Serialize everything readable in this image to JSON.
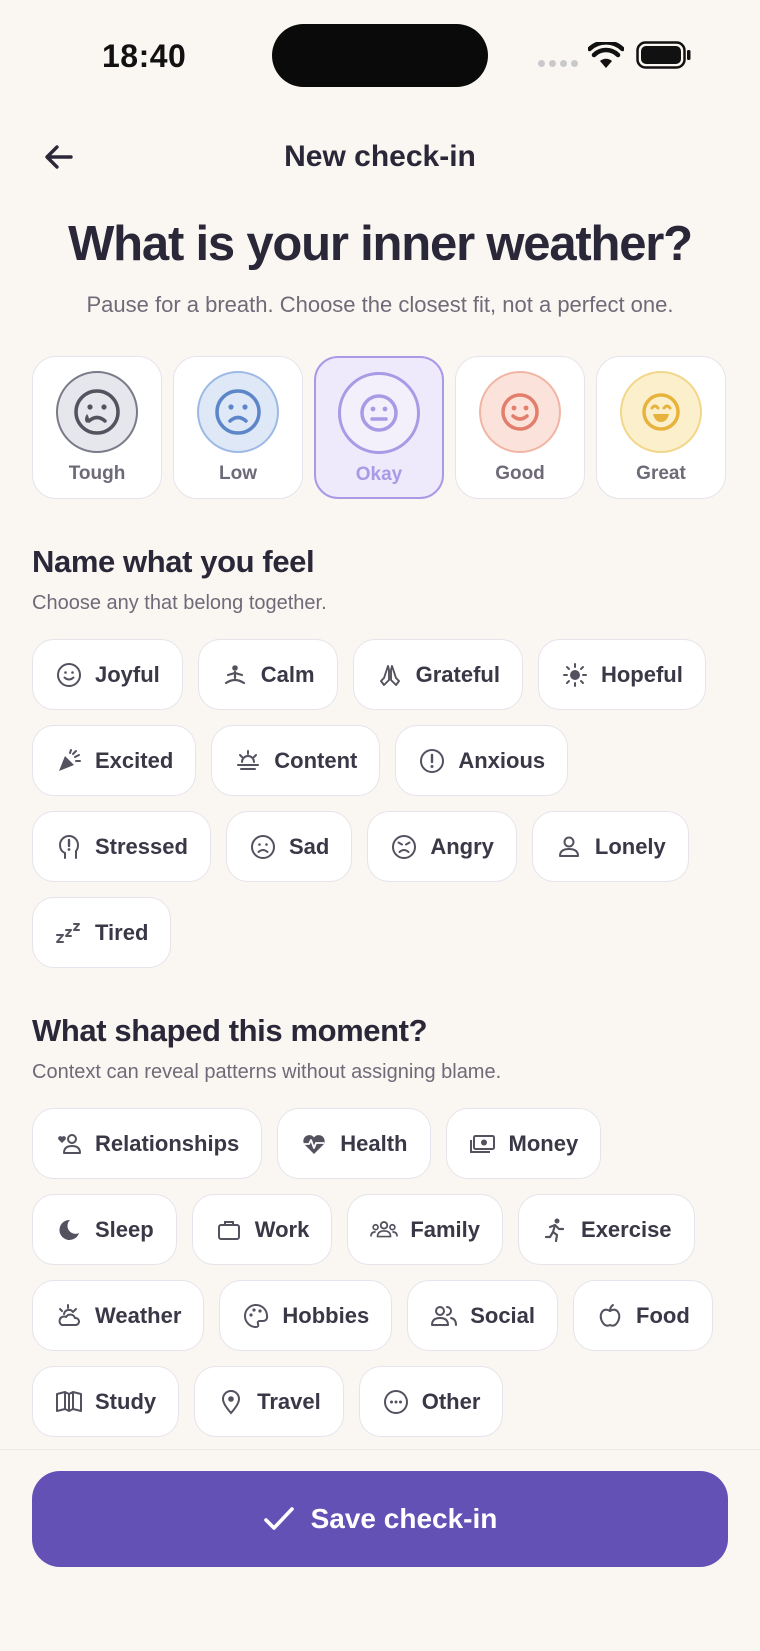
{
  "status_bar": {
    "time": "18:40"
  },
  "header": {
    "title": "New check-in"
  },
  "main_title": "What is your inner weather?",
  "subtitle": "Pause for a breath. Choose the closest fit, not a perfect one.",
  "moods": [
    {
      "label": "Tough",
      "color": "#7A7A88",
      "bg": "#E6E7EC",
      "selected": false
    },
    {
      "label": "Low",
      "color": "#5D86C9",
      "bg": "#DEE8F6",
      "selected": false
    },
    {
      "label": "Okay",
      "color": "#A99AE6",
      "bg": "#EEE9FB",
      "selected": true
    },
    {
      "label": "Good",
      "color": "#E27E6B",
      "bg": "#FBE2DA",
      "selected": false
    },
    {
      "label": "Great",
      "color": "#E8B33C",
      "bg": "#FCF0CC",
      "selected": false
    }
  ],
  "feelings_section": {
    "title": "Name what you feel",
    "subtitle": "Choose any that belong together.",
    "chips": [
      "Joyful",
      "Calm",
      "Grateful",
      "Hopeful",
      "Excited",
      "Content",
      "Anxious",
      "Stressed",
      "Sad",
      "Angry",
      "Lonely",
      "Tired"
    ]
  },
  "context_section": {
    "title": "What shaped this moment?",
    "subtitle": "Context can reveal patterns without assigning blame.",
    "chips": [
      "Relationships",
      "Health",
      "Money",
      "Sleep",
      "Work",
      "Family",
      "Exercise",
      "Weather",
      "Hobbies",
      "Social",
      "Food",
      "Study",
      "Travel",
      "Other"
    ]
  },
  "save_button": {
    "label": "Save check-in"
  },
  "colors": {
    "accent": "#6351B6",
    "background": "#FAF7F2"
  }
}
